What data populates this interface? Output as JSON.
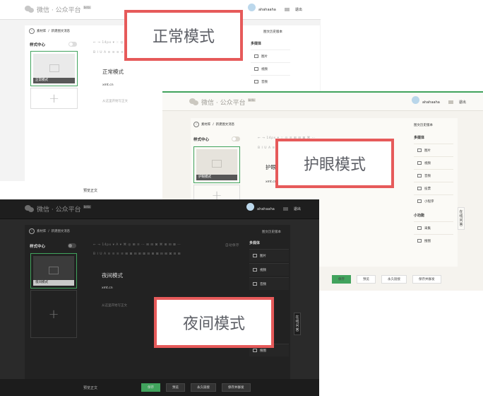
{
  "common": {
    "brand": "微信 · 公众平台",
    "beta": "beta",
    "user_name": "ahahaaha",
    "logout": "退出",
    "breadcrumb_root": "素材库",
    "breadcrumb_sep": "/",
    "breadcrumb_current": "新建图文消息",
    "history_versions": "图文历史版本",
    "style_center": "样式中心",
    "media_heading": "多媒体",
    "media_items": [
      "图片",
      "视频",
      "音频",
      "投票",
      "小程序"
    ],
    "mini_heading": "小功能",
    "mini_items": [
      "采集",
      "搜图"
    ],
    "author": "xmt.cn",
    "summary_placeholder": "从这里开始写正文",
    "float_tab": "在线问答",
    "preview_body": "预览正文",
    "footer_buttons": [
      "保存",
      "预览",
      "永久链接",
      "保存并群发"
    ],
    "plus": "+",
    "back_arrow": "‹",
    "toolbar_row1": "←  →  14px ▾  ⁙  ◎  ≡  ⊞  ⊟  ⊠  ⌘  ⋯",
    "toolbar_row2": "B  I  U  A  ≡  ≡  ≡  ≡  ⊞  ⊠  ⋯",
    "night_toolbar_row1": "←  →  14px ▾  A ▾  ⌘  ◎  ⊞  ≡  ⋯  ⊞  ⊟  ⊠  ⌘  ⊞  ⊟  ⊠  ⋯",
    "night_toolbar_row2": "B  I  U  A  ≡  ≡  ≡  ≡  ⊞  ⊠  ⊟  ⊞  ⊠  ⊟  ⊞  ⊠  ⊟  ⊞  ⊠  ⊟  ⊞"
  },
  "normal": {
    "label": "正常模式",
    "article_caption": "正常模式",
    "title": "正常模式"
  },
  "eye": {
    "label": "护眼模式",
    "article_caption": "护眼模式",
    "title": "护眼"
  },
  "night": {
    "label": "夜间模式",
    "article_caption": "夜间模式",
    "title": "夜间模式",
    "toolbar_extra": "自动保存"
  },
  "colors": {
    "accent_green": "#41a35d",
    "label_border": "#e65a5a",
    "label_text": "#5d5f66",
    "eye_bg": "#f5f3ee",
    "night_bg": "#2a2a2a"
  },
  "icons": [
    "wechat-logo-icon",
    "avatar-icon",
    "message-icon",
    "back-icon",
    "toggle-icon",
    "image-icon",
    "video-icon",
    "audio-icon",
    "vote-icon",
    "mini-program-icon",
    "collect-icon",
    "search-image-icon"
  ]
}
